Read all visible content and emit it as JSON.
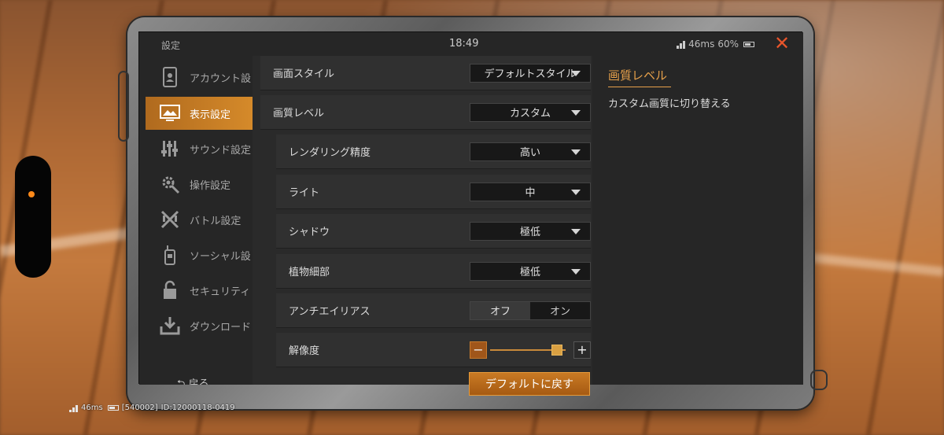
{
  "header": {
    "title": "設定",
    "clock": "18:49",
    "ping": "46ms",
    "battery": "60%"
  },
  "sidebar": {
    "items": [
      {
        "label": "アカウント設",
        "icon": "phone-icon"
      },
      {
        "label": "表示設定",
        "icon": "monitor-icon",
        "active": true
      },
      {
        "label": "サウンド設定",
        "icon": "equalizer-icon"
      },
      {
        "label": "操作設定",
        "icon": "gear-icon"
      },
      {
        "label": "バトル設定",
        "icon": "crossed-weapons-icon"
      },
      {
        "label": "ソーシャル設",
        "icon": "walkie-talkie-icon"
      },
      {
        "label": "セキュリティ",
        "icon": "padlock-icon"
      },
      {
        "label": "ダウンロード",
        "icon": "download-icon"
      }
    ],
    "back_label": "戻る"
  },
  "settings": {
    "screen_style": {
      "label": "画面スタイル",
      "value": "デフォルトスタイル"
    },
    "quality_level": {
      "label": "画質レベル",
      "value": "カスタム"
    },
    "rendering": {
      "label": "レンダリング精度",
      "value": "高い"
    },
    "light": {
      "label": "ライト",
      "value": "中"
    },
    "shadow": {
      "label": "シャドウ",
      "value": "極低"
    },
    "foliage": {
      "label": "植物細部",
      "value": "極低"
    },
    "antialias": {
      "label": "アンチエイリアス",
      "options": [
        "オフ",
        "オン"
      ],
      "selected": "オフ"
    },
    "resolution": {
      "label": "解像度",
      "level": 0.95
    }
  },
  "default_button": "デフォルトに戻す",
  "info": {
    "title": "画質レベル",
    "description": "カスタム画質に切り替える"
  },
  "bottom_status": {
    "ping": "46ms",
    "server": "[540002]",
    "id": "ID:12000118-0419"
  },
  "colors": {
    "accent": "#d58a2a",
    "close": "#e8552b",
    "info_title": "#e6a04a"
  }
}
